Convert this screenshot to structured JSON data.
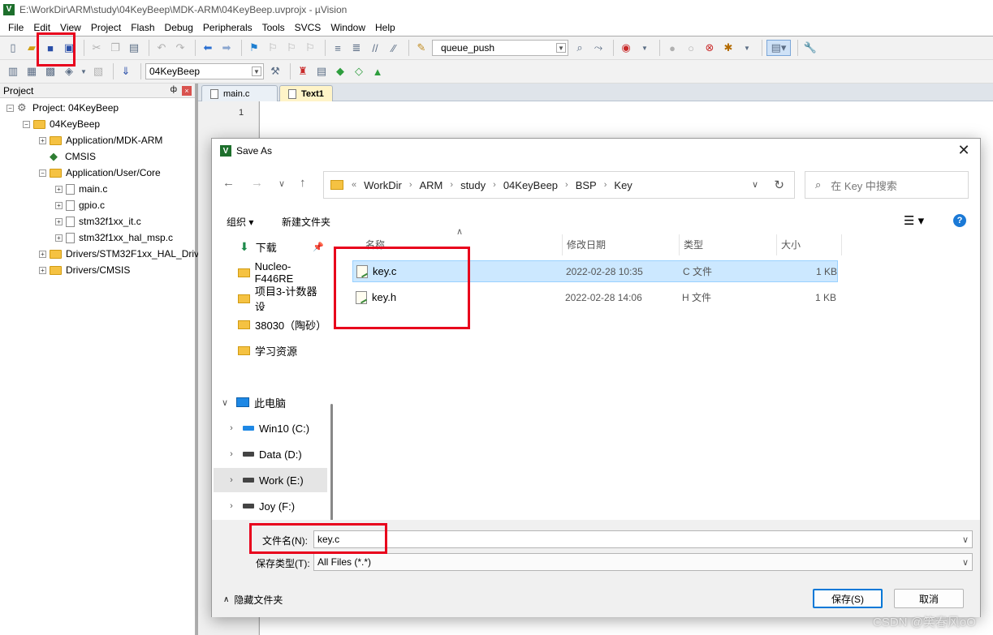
{
  "window": {
    "title": "E:\\WorkDir\\ARM\\study\\04KeyBeep\\MDK-ARM\\04KeyBeep.uvprojx - µVision",
    "app_icon_letter": "V"
  },
  "menu": [
    "File",
    "Edit",
    "View",
    "Project",
    "Flash",
    "Debug",
    "Peripherals",
    "Tools",
    "SVCS",
    "Window",
    "Help"
  ],
  "toolbar": {
    "find_combo_value": "queue_push",
    "target_combo_value": "04KeyBeep"
  },
  "project_pane": {
    "title": "Project",
    "pin": "ф",
    "close": "×",
    "tree": [
      {
        "label": "Project: 04KeyBeep",
        "expander": "−"
      },
      {
        "label": "04KeyBeep",
        "expander": "−"
      },
      {
        "label": "Application/MDK-ARM",
        "expander": "+"
      },
      {
        "label": "CMSIS",
        "expander": ""
      },
      {
        "label": "Application/User/Core",
        "expander": "−"
      },
      {
        "label": "main.c",
        "expander": "+"
      },
      {
        "label": "gpio.c",
        "expander": "+"
      },
      {
        "label": "stm32f1xx_it.c",
        "expander": "+"
      },
      {
        "label": "stm32f1xx_hal_msp.c",
        "expander": "+"
      },
      {
        "label": "Drivers/STM32F1xx_HAL_Driv",
        "expander": "+"
      },
      {
        "label": "Drivers/CMSIS",
        "expander": "+"
      }
    ]
  },
  "editor": {
    "tabs": [
      {
        "label": "main.c"
      },
      {
        "label": "Text1"
      }
    ],
    "line_number": "1"
  },
  "dialog": {
    "title": "Save As",
    "close": "✕",
    "address": {
      "prefix": "«",
      "crumbs": [
        "WorkDir",
        "ARM",
        "study",
        "04KeyBeep",
        "BSP",
        "Key"
      ]
    },
    "search_placeholder": "在 Key 中搜索",
    "organize": "组织 ▾",
    "new_folder": "新建文件夹",
    "view_btn": "☰ ▾",
    "help": "?",
    "nav_items": [
      {
        "label": "下载",
        "type": "download"
      },
      {
        "label": "Nucleo-F446RE",
        "type": "folder"
      },
      {
        "label": "项目3-计数器设",
        "type": "folder"
      },
      {
        "label": "38030（陶砂）",
        "type": "folder"
      },
      {
        "label": "学习资源",
        "type": "folder"
      },
      {
        "label": "此电脑",
        "type": "pc"
      },
      {
        "label": "Win10 (C:)",
        "type": "drive"
      },
      {
        "label": "Data (D:)",
        "type": "drive"
      },
      {
        "label": "Work (E:)",
        "type": "drive"
      },
      {
        "label": "Joy (F:)",
        "type": "drive"
      }
    ],
    "columns": [
      "名称",
      "修改日期",
      "类型",
      "大小"
    ],
    "files": [
      {
        "name": "key.c",
        "date": "2022-02-28 10:35",
        "type": "C 文件",
        "size": "1 KB"
      },
      {
        "name": "key.h",
        "date": "2022-02-28 14:06",
        "type": "H 文件",
        "size": "1 KB"
      }
    ],
    "filename_label": "文件名(N):",
    "filename_value": "key.c",
    "filetype_label": "保存类型(T):",
    "filetype_value": "All Files (*.*)",
    "hide_folders": "隐藏文件夹",
    "save_button": "保存(S)",
    "cancel_button": "取消"
  },
  "watermark": "CSDN @笑春风oO"
}
